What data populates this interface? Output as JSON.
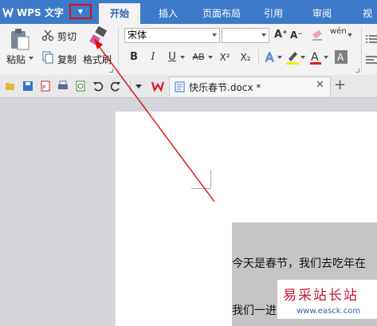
{
  "app": {
    "title": "WPS 文字"
  },
  "tabs": [
    {
      "label": "开始",
      "active": true
    },
    {
      "label": "插入"
    },
    {
      "label": "页面布局"
    },
    {
      "label": "引用"
    },
    {
      "label": "审阅"
    },
    {
      "label": "视"
    }
  ],
  "ribbon": {
    "clipboard": {
      "paste_label": "粘贴",
      "cut_label": "剪切",
      "copy_label": "复制",
      "format_painter_label": "格式刷"
    },
    "font": {
      "name": "宋体",
      "size": "",
      "bold": "B",
      "italic": "I",
      "underline": "U",
      "strike": "AB",
      "superscript": "X²",
      "subscript": "X₂",
      "grow": "A⁺",
      "shrink": "A⁻",
      "phonetic": "wén"
    }
  },
  "document": {
    "tab_title": "快乐春节.docx *",
    "text_line_1": "今天是春节，我们去吃年在",
    "text_line_2": "我们一进"
  },
  "watermark": {
    "text": "易采站长站",
    "url": "www.easck.com"
  },
  "colors": {
    "brand_blue": "#3d7ac9",
    "highlight_red": "#e01010",
    "accent_red": "#c4172e"
  }
}
